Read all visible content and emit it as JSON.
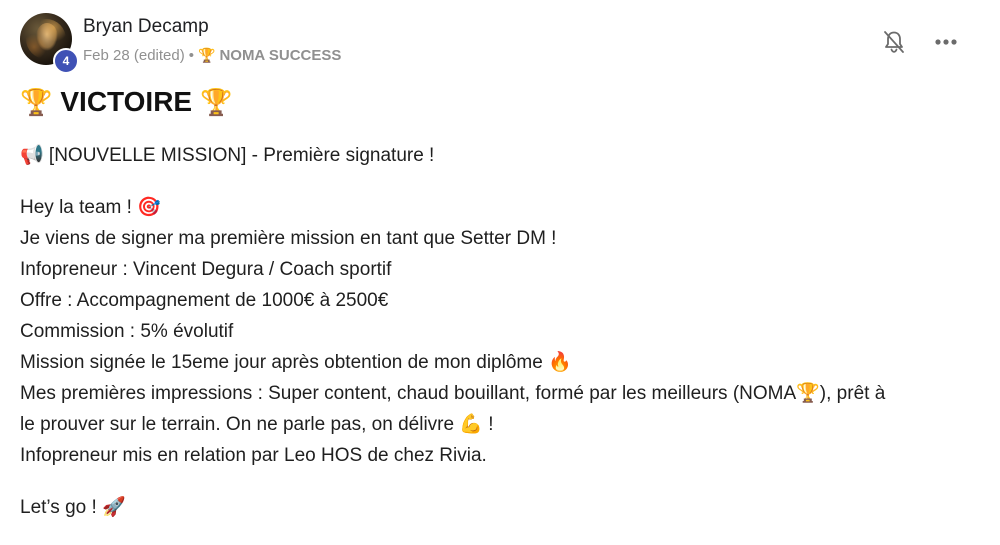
{
  "author": {
    "name": "Bryan Decamp",
    "level": "4",
    "avatar": "avatar-photo"
  },
  "meta": {
    "date": "Feb 28 (edited)",
    "separator": "•",
    "category_icon": "🏆",
    "category": "NOMA SUCCESS"
  },
  "actions": {
    "bell_icon": "bell-off-icon",
    "more_icon": "more-horizontal-icon"
  },
  "title": {
    "emoji_left": "🏆",
    "text": "VICTOIRE",
    "emoji_right": "🏆"
  },
  "body": {
    "mission_line": "📢 [NOUVELLE MISSION] - Première signature !",
    "greeting": "Hey la team ! 🎯",
    "line1": "Je viens de signer ma première mission en tant que Setter DM !",
    "line2": "Infopreneur : Vincent Degura / Coach sportif",
    "line3": "Offre : Accompagnement de 1000€ à 2500€",
    "line4": "Commission : 5% évolutif",
    "line5": "Mission signée le 15eme jour après obtention de mon diplôme 🔥",
    "line6a": "Mes premières impressions : Super content, chaud bouillant, formé par les meilleurs (NOMA🏆), prêt à",
    "line6b": "le prouver sur le terrain. On ne parle pas, on délivre 💪 !",
    "line7": "Infopreneur mis en relation par Leo HOS de chez Rivia.",
    "closing": "Let’s go ! 🚀"
  }
}
